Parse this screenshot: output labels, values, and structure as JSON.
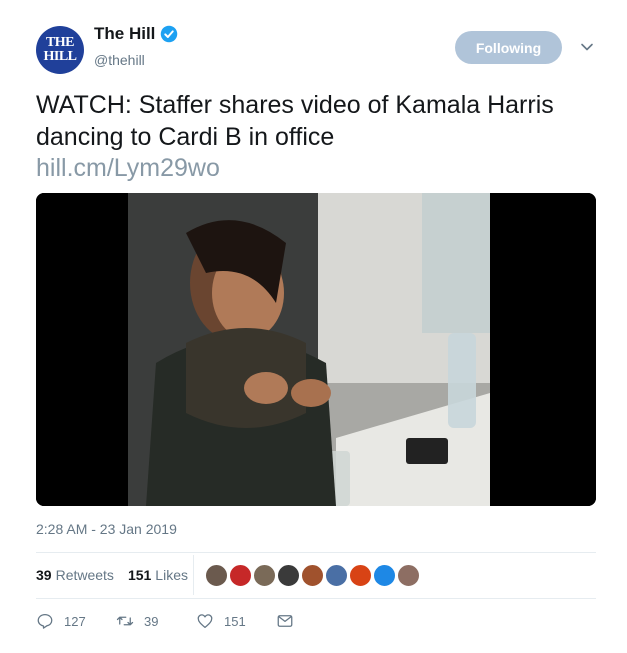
{
  "account": {
    "avatar_line1": "THE",
    "avatar_line2": "HILL",
    "name": "The Hill",
    "handle": "@thehill"
  },
  "follow_label": "Following",
  "tweet": {
    "text": "WATCH: Staffer shares video of Kamala Harris dancing to Cardi B in office",
    "link": "hill.cm/Lym29wo",
    "timestamp": "2:28 AM - 23 Jan 2019"
  },
  "stats": {
    "retweets_count": "39",
    "retweets_label": "Retweets",
    "likes_count": "151",
    "likes_label": "Likes"
  },
  "likers": [
    "#6b5a4e",
    "#c62828",
    "#7a6a58",
    "#3a3a3a",
    "#a0522d",
    "#4a6fa5",
    "#d84315",
    "#1e88e5",
    "#8d6e63"
  ],
  "actions": {
    "reply_count": "127",
    "retweet_count": "39",
    "like_count": "151"
  },
  "colors": {
    "brand_blue": "#20409a",
    "verified_blue": "#1da1f2",
    "following_button": "#b0c4d9",
    "secondary_text": "#657786",
    "link_text": "#8899a6"
  },
  "icons": [
    "verified-badge-icon",
    "chevron-down-icon",
    "reply-icon",
    "retweet-icon",
    "like-icon",
    "direct-message-icon"
  ]
}
